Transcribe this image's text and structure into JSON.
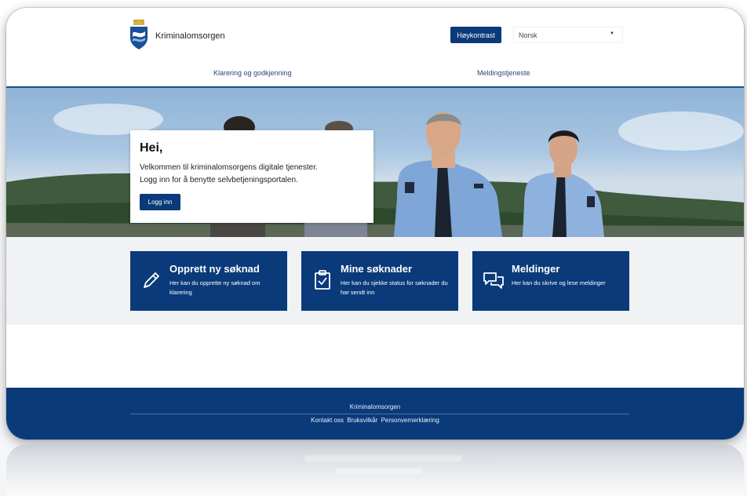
{
  "header": {
    "brand": "Kriminalomsorgen",
    "contrast_button": "Høykontrast",
    "language_value": "Norsk"
  },
  "nav": {
    "items": [
      {
        "label": "Klarering og godkjenning"
      },
      {
        "label": "Meldingstjeneste"
      }
    ]
  },
  "hero": {
    "greeting": "Hei,",
    "line1": "Velkommen til kriminalomsorgens digitale tjenester.",
    "line2": "Logg inn for å benytte selvbetjeningsportalen.",
    "login_button": "Logg inn"
  },
  "cards": [
    {
      "title": "Opprett ny søknad",
      "desc": "Her kan du opprette ny søknad om klarering",
      "icon": "pencil-icon"
    },
    {
      "title": "Mine søknader",
      "desc": "Her kan du sjekke status for søknader du har sendt inn",
      "icon": "clipboard-check-icon"
    },
    {
      "title": "Meldinger",
      "desc": "Her kan du skrive og lese meldinger",
      "icon": "chat-bubbles-icon"
    }
  ],
  "footer": {
    "title": "Kriminalomsorgen",
    "links": [
      {
        "label": "Kontakt oss"
      },
      {
        "label": "Bruksvilkår"
      },
      {
        "label": "Personvernerklæring"
      }
    ]
  },
  "colors": {
    "brand_navy": "#0a3a7a",
    "nav_rule": "#1d4e8f",
    "band_bg": "#f1f2f4"
  }
}
